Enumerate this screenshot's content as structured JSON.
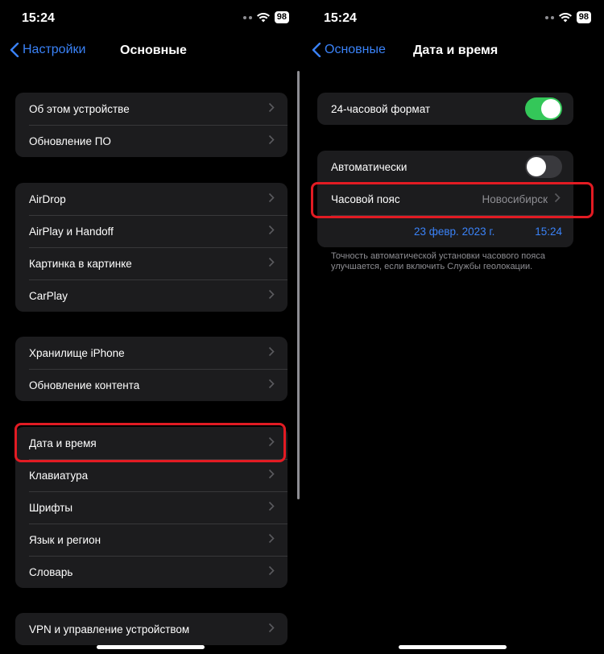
{
  "left": {
    "status": {
      "time": "15:24",
      "battery": "98"
    },
    "nav": {
      "back": "Настройки",
      "title": "Основные"
    },
    "groups": [
      [
        "Об этом устройстве",
        "Обновление ПО"
      ],
      [
        "AirDrop",
        "AirPlay и Handoff",
        "Картинка в картинке",
        "CarPlay"
      ],
      [
        "Хранилище iPhone",
        "Обновление контента"
      ],
      [
        "Дата и время",
        "Клавиатура",
        "Шрифты",
        "Язык и регион",
        "Словарь"
      ],
      [
        "VPN и управление устройством"
      ]
    ]
  },
  "right": {
    "status": {
      "time": "15:24",
      "battery": "98"
    },
    "nav": {
      "back": "Основные",
      "title": "Дата и время"
    },
    "format24": {
      "label": "24-часовой формат",
      "on": true
    },
    "auto": {
      "label": "Автоматически",
      "on": false
    },
    "timezone": {
      "label": "Часовой пояс",
      "value": "Новосибирск"
    },
    "date": "23 февр. 2023 г.",
    "time": "15:24",
    "footnote": "Точность автоматической установки часового пояса улучшается, если включить Службы геолокации."
  },
  "colors": {
    "accent": "#3a82f7",
    "toggle_on": "#34c759",
    "highlight": "#e21b23"
  }
}
